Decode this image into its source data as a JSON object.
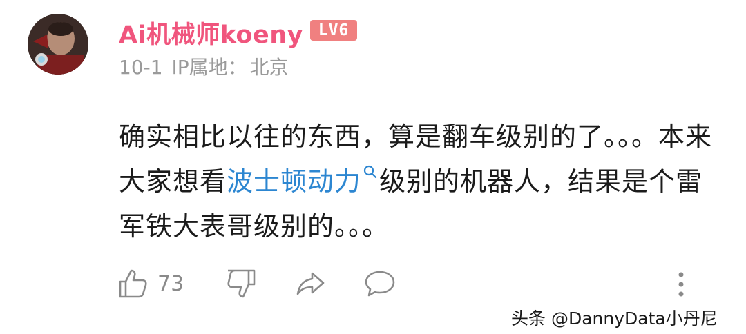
{
  "user": {
    "name": "Ai机械师koeny",
    "level_badge": "LV6",
    "date": "10-1",
    "ip_label": "IP属地：",
    "ip_location": "北京"
  },
  "comment": {
    "part1": "确实相比以往的东西，算是翻车级别的了。。。本来大家想看",
    "link_text": "波士顿动力",
    "part2": "级别的机器人，结果是个雷军铁大表哥级别的。。。"
  },
  "actions": {
    "like_count": "73"
  },
  "icons": [
    "thumbs-up-icon",
    "thumbs-down-icon",
    "share-icon",
    "comment-icon",
    "more-icon",
    "search-icon"
  ],
  "colors": {
    "username": "#f0557d",
    "badge": "#f08080",
    "link": "#2c86d1",
    "meta": "#9a9a9a"
  },
  "watermark": "头条 @DannyData小丹尼"
}
